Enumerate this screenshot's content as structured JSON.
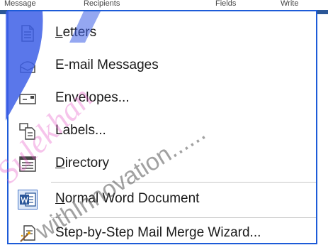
{
  "top_tabs": [
    "Message",
    "Recipients",
    "",
    "Fields",
    "Write"
  ],
  "menu": {
    "items": [
      {
        "label": "Letters",
        "accel": "L",
        "rest": "etters",
        "icon": "letter-icon"
      },
      {
        "label": "E-mail Messages",
        "accel": "",
        "rest": "E-mail Messages",
        "icon": "email-icon"
      },
      {
        "label": "Envelopes...",
        "accel": "",
        "rest": "Envelopes...",
        "icon": "envelope-icon"
      },
      {
        "label": "Labels...",
        "accel": "",
        "rest": "Labels...",
        "icon": "labels-icon"
      },
      {
        "label": "Directory",
        "accel": "D",
        "rest": "irectory",
        "icon": "directory-icon"
      },
      {
        "label": "Normal Word Document",
        "accel": "N",
        "rest": "ormal Word Document",
        "icon": "word-icon"
      },
      {
        "label": "Step-by-Step Mail Merge Wizard...",
        "accel": "",
        "rest": "Step-by-Step Mail Merge Wizard...",
        "icon": "wizard-icon"
      }
    ]
  },
  "watermark": {
    "text": "withInnovation......",
    "text2": "Sulekhan"
  },
  "colors": {
    "frame": "#1d5bd8",
    "topbar": "#2b5797",
    "watermark_blue": "#3d5fe6",
    "watermark_pink": "#e85ac8"
  }
}
